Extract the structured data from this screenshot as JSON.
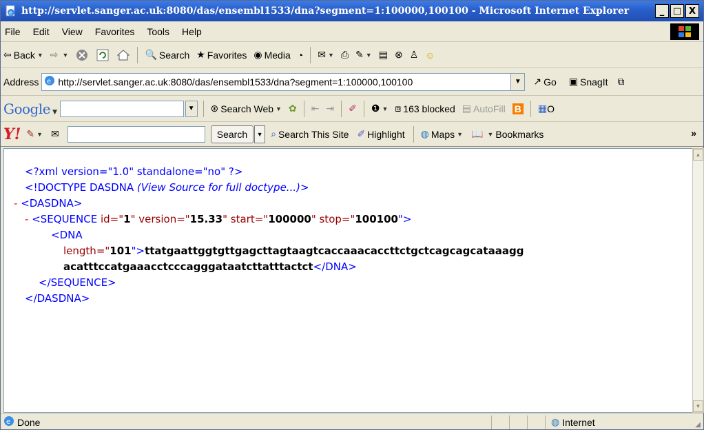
{
  "window": {
    "title": "http://servlet.sanger.ac.uk:8080/das/ensembl1533/dna?segment=1:100000,100100 - Microsoft Internet Explorer",
    "minimize": "_",
    "maximize": "□",
    "close": "X"
  },
  "menu": [
    "File",
    "Edit",
    "View",
    "Favorites",
    "Tools",
    "Help"
  ],
  "toolbar": {
    "back": "Back",
    "search": "Search",
    "favorites": "Favorites",
    "media": "Media"
  },
  "address": {
    "label": "Address",
    "value": "http://servlet.sanger.ac.uk:8080/das/ensembl1533/dna?segment=1:100000,100100",
    "go": "Go",
    "snagit": "SnagIt"
  },
  "google": {
    "logo": "Google",
    "search_web": "Search Web",
    "blocked": "163 blocked",
    "autofill": "AutoFill",
    "options": "O"
  },
  "yahoo": {
    "logo": "Y!",
    "search_button": "Search",
    "search_site": "Search This Site",
    "highlight": "Highlight",
    "maps": "Maps",
    "bookmarks": "Bookmarks",
    "more": "»"
  },
  "xml": {
    "pi": "<?xml version=\"1.0\" standalone=\"no\" ?>",
    "doctype_open": "<!DOCTYPE DASDNA ",
    "doctype_note": "(View Source for full doctype...)",
    "doctype_close": ">",
    "dasdna_open": "<DASDNA>",
    "seq_tag": "<SEQUENCE ",
    "seq_id_attr": "id=\"",
    "seq_id": "1",
    "seq_version_attr": "\" version=\"",
    "seq_version": "15.33",
    "seq_start_attr": "\" start=\"",
    "seq_start": "100000",
    "seq_stop_attr": "\" stop=\"",
    "seq_stop": "100100",
    "seq_end": "\">",
    "dna_open": "<DNA",
    "dna_length_attr": "length=\"",
    "dna_length": "101",
    "dna_length_end": "\">",
    "dna_seq_1": "ttatgaattggtgttgagcttagtaagtcaccaaacaccttctgctcagcagcataaagg",
    "dna_seq_2": "acatttccatgaaacctcccagggataatcttatttactct",
    "dna_close": "</DNA>",
    "seq_close": "</SEQUENCE>",
    "dasdna_close": "</DASDNA>",
    "minus": "-"
  },
  "status": {
    "left": "Done",
    "zone": "Internet"
  }
}
